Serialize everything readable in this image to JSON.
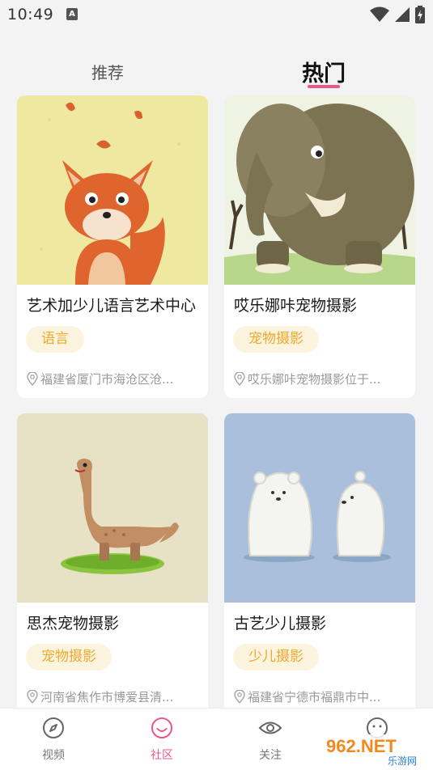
{
  "status_bar": {
    "time": "10:49",
    "notification_icon": "A",
    "icons": [
      "wifi-icon",
      "signal-icon",
      "battery-icon"
    ]
  },
  "tabs": [
    {
      "label": "推荐",
      "active": false
    },
    {
      "label": "热门",
      "active": true
    }
  ],
  "accent_color": "#e8588a",
  "tag_color": "#efa92d",
  "cards": [
    {
      "title": "艺术加少儿语言艺术中心",
      "tag": "语言",
      "location": "福建省厦门市海沧区沧...",
      "image": "fox-illustration"
    },
    {
      "title": "哎乐娜咔宠物摄影",
      "tag": "宠物摄影",
      "location": "哎乐娜咔宠物摄影位于...",
      "image": "elephant-illustration"
    },
    {
      "title": "思杰宠物摄影",
      "tag": "宠物摄影",
      "location": "河南省焦作市博爱县清...",
      "image": "dinosaur-illustration"
    },
    {
      "title": "古艺少儿摄影",
      "tag": "少儿摄影",
      "location": "福建省宁德市福鼎市中...",
      "image": "polar-bears-illustration"
    }
  ],
  "bottom_nav": [
    {
      "label": "视频",
      "icon": "compass-icon",
      "active": false
    },
    {
      "label": "社区",
      "icon": "smile-icon",
      "active": true
    },
    {
      "label": "关注",
      "icon": "eye-icon",
      "active": false
    },
    {
      "label": "",
      "icon": "profile-icon",
      "active": false
    }
  ],
  "watermark": {
    "text": "962.NET",
    "subtext": "乐游网"
  }
}
